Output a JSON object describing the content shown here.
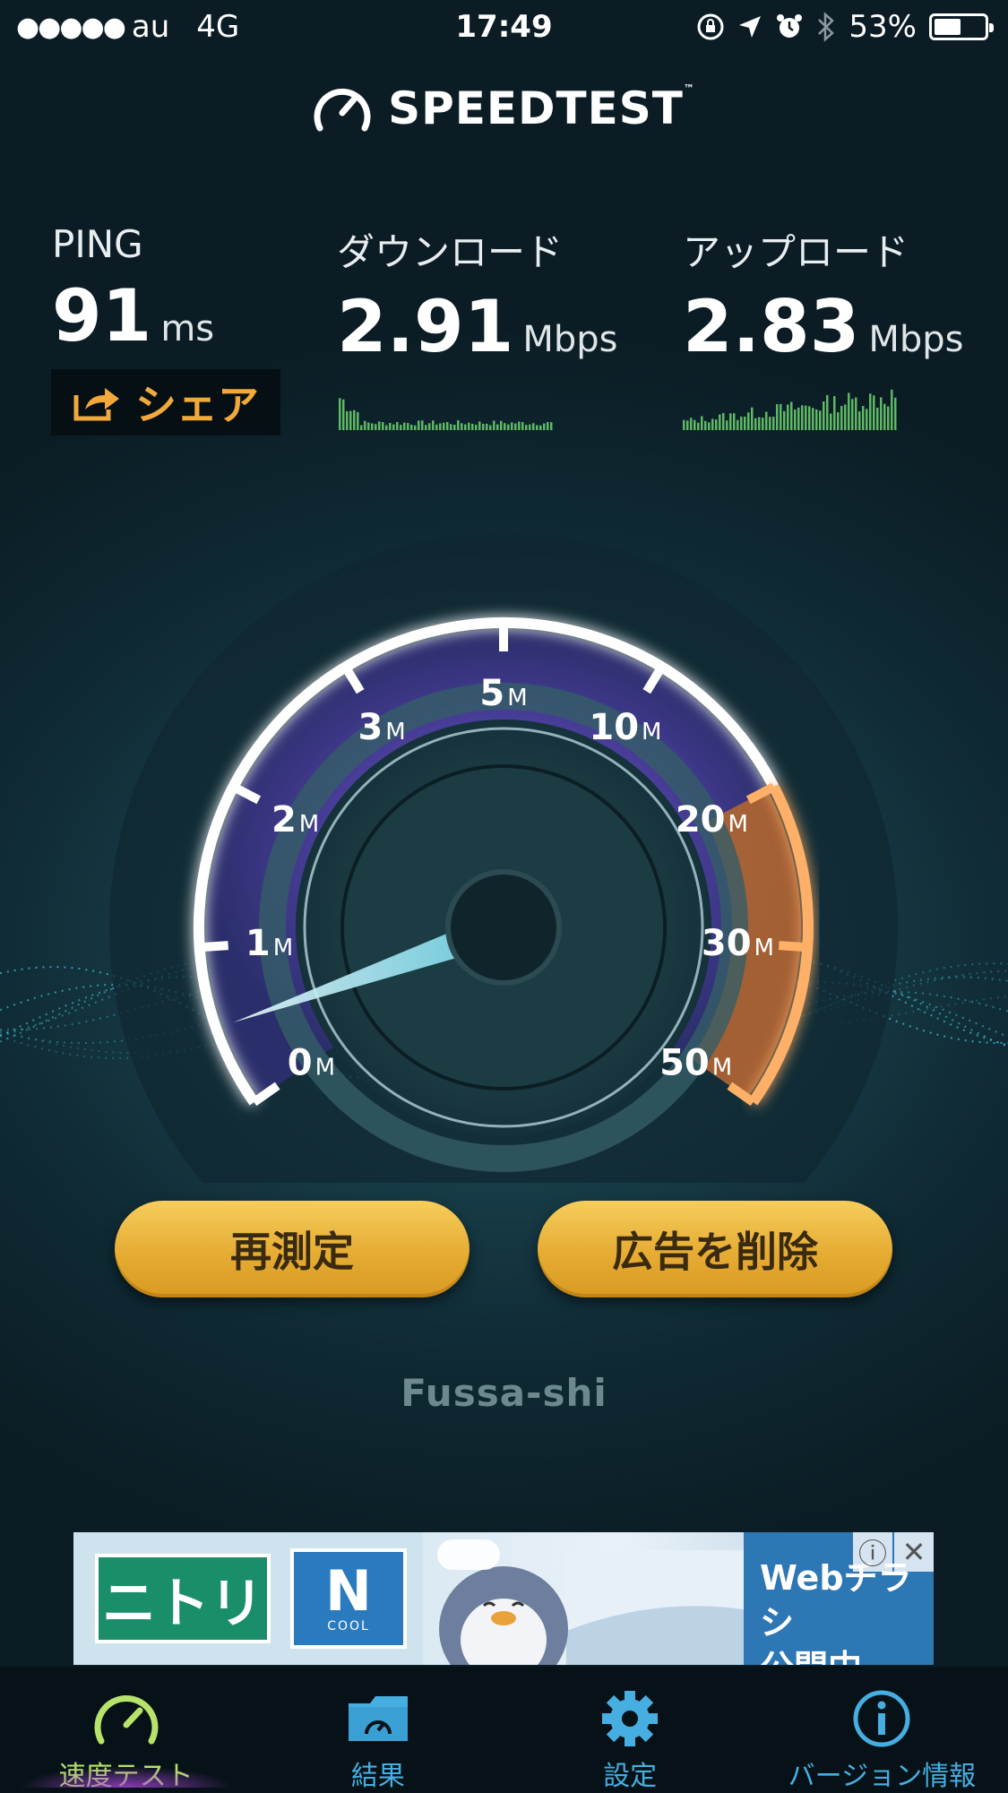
{
  "statusbar": {
    "carrier": "au",
    "network": "4G",
    "time": "17:49",
    "battery": "53%",
    "battery_level": 0.53
  },
  "logo": {
    "text": "SPEEDTEST",
    "tm": "™"
  },
  "metrics": {
    "ping": {
      "label": "PING",
      "value": "91",
      "unit": "ms"
    },
    "download": {
      "label": "ダウンロード",
      "value": "2.91",
      "unit": "Mbps"
    },
    "upload": {
      "label": "アップロード",
      "value": "2.83",
      "unit": "Mbps"
    }
  },
  "share_label": "シェア",
  "gauge": {
    "ticks": [
      {
        "num": "0",
        "unit": "M"
      },
      {
        "num": "1",
        "unit": "M"
      },
      {
        "num": "2",
        "unit": "M"
      },
      {
        "num": "3",
        "unit": "M"
      },
      {
        "num": "5",
        "unit": "M"
      },
      {
        "num": "10",
        "unit": "M"
      },
      {
        "num": "20",
        "unit": "M"
      },
      {
        "num": "30",
        "unit": "M"
      },
      {
        "num": "50",
        "unit": "M"
      }
    ],
    "needle_value_mbps": 0.5
  },
  "buttons": {
    "retest": "再測定",
    "remove_ads": "広告を削除"
  },
  "location": "Fussa-shi",
  "ad": {
    "brand": "ニトリ",
    "product_n": "N",
    "product_cool": "COOL",
    "text_line1": "Webチラシ",
    "text_line2": "公開中"
  },
  "tabs": [
    {
      "label": "速度テスト",
      "icon": "speedometer-icon",
      "active": true
    },
    {
      "label": "結果",
      "icon": "results-folder-icon",
      "active": false
    },
    {
      "label": "設定",
      "icon": "gear-icon",
      "active": false
    },
    {
      "label": "バージョン情報",
      "icon": "info-icon",
      "active": false
    }
  ],
  "colors": {
    "accent_gold": "#f2a93b",
    "tab_active": "#b7e36a",
    "tab_inactive": "#46aee0"
  }
}
